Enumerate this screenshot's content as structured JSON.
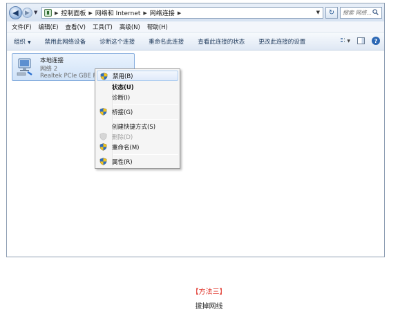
{
  "address_bar": {
    "breadcrumbs": [
      "控制面板",
      "网络和 Internet",
      "网络连接"
    ],
    "search_placeholder": "搜索 网络...",
    "refresh_symbol": "↻"
  },
  "menu": [
    "文件(F)",
    "编辑(E)",
    "查看(V)",
    "工具(T)",
    "高级(N)",
    "帮助(H)"
  ],
  "command_bar": {
    "organize": "组织",
    "disable_device": "禁用此网络设备",
    "diagnose": "诊断这个连接",
    "rename": "重命名此连接",
    "view_status": "查看此连接的状态",
    "change_settings": "更改此连接的设置"
  },
  "connection": {
    "name": "本地连接",
    "network": "网络  2",
    "device": "Realtek PCIe GBE Fa"
  },
  "context_menu": {
    "disable": "禁用(B)",
    "status": "状态(U)",
    "diagnose": "诊断(I)",
    "bridge": "桥接(G)",
    "shortcut": "创建快捷方式(S)",
    "delete": "删除(D)",
    "rename": "重命名(M)",
    "properties": "属性(R)"
  },
  "caption": {
    "method_title": "【方法三】",
    "method_text": "拔掉网线"
  },
  "colors": {
    "accent_red": "#e0342a",
    "highlight": "#aecdf0",
    "shield_blue": "#2d6cc0",
    "shield_yellow": "#f4c51d"
  }
}
